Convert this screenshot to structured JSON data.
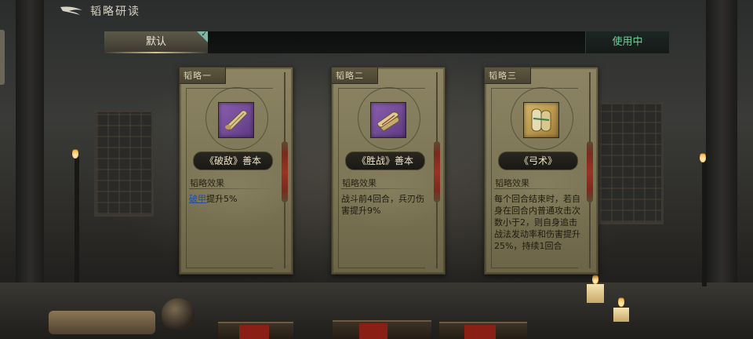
{
  "header": {
    "title": "韬略研读"
  },
  "tabs": {
    "active_label": "默认",
    "status_label": "使用中"
  },
  "cards": [
    {
      "label": "韬略一",
      "name": "《破敌》善本",
      "effect_title": "韬略效果",
      "effect_keyword": "破甲",
      "effect_text": "提升5%",
      "icon": "scroll-icon",
      "icon_bg": "#7a55a0"
    },
    {
      "label": "韬略二",
      "name": "《胜战》善本",
      "effect_title": "韬略效果",
      "effect_text": "战斗前4回合，兵刃伤害提升9%",
      "icon": "scroll-icon",
      "icon_bg": "#7a55a0"
    },
    {
      "label": "韬略三",
      "name": "《弓术》",
      "effect_title": "韬略效果",
      "effect_text": "每个回合结束时，若自身在回合内普通攻击次数小于2，则自身追击战法发动率和伤害提升25%，持续1回合",
      "icon": "scroll-icon",
      "icon_bg": "#c9a85c"
    }
  ]
}
